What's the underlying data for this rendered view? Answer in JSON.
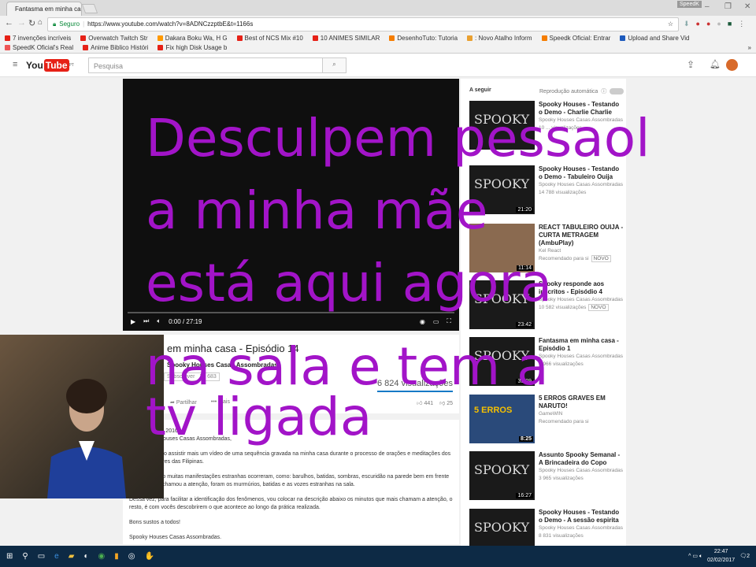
{
  "browser": {
    "tab_title": "Fantasma em minha casa",
    "profile": "SpeedK",
    "secure_label": "Seguro",
    "url": "https://www.youtube.com/watch?v=8ADNCzzptbE&t=1166s",
    "bookmarks": [
      "7 invenções incríveis",
      "Overwatch Twitch Str",
      "Dakara Boku Wa, H G",
      "Best of NCS Mix #10",
      "10 ANIMES SIMILAR",
      "DesenhoTuto: Tutoria",
      ": Novo Atalho Inform",
      "Speedk Oficial: Entrar",
      "Upload and Share Vid",
      "SpeedK Oficial's Real",
      "Anime Biblico Históri",
      "Fix high Disk Usage b"
    ],
    "more": "»"
  },
  "youtube": {
    "logo_you": "You",
    "logo_tube": "Tube",
    "region": "PT",
    "search_placeholder": "Pesquisa"
  },
  "player": {
    "time": "0:00 / 27:19"
  },
  "video": {
    "title": "em minha casa - Episódio 14",
    "channel": "Spooky Houses Casas Assombradas",
    "subscribe": "Subscrever",
    "subs": "20 683",
    "views": "6 824 visualizações",
    "share": "Partilhar",
    "more": "Mais",
    "likes": "441",
    "dislikes": "25"
  },
  "description": [
    "Publicado a ... 2016",
    "Olá Spooky Houses Casas Assombradas,",
    "Hoje vocês vão assistir mais um vídeo de uma sequência gravada na minha casa durante o processo de orações e meditações dos grandes mestres das Filipinas.",
    "Neste episódio muitas manifestações estranhas ocorreram, como: barulhos, batidas, sombras, escuridão na parede bem em frente e o que mais chamou a atenção, foram os murmúrios, batidas e as vozes estranhas na sala.",
    "Dessa vez, para facilitar a identificação dos fenômenos, vou colocar na descrição abaixo os minutos que mais chamam a atenção, o resto, é com vocês descobrirem o que acontece ao longo da prática realizada.",
    "Bons sustos a todos!",
    "Spooky Houses Casas Assombradas."
  ],
  "sidebar": {
    "up_next": "A seguir",
    "autoplay": "Reprodução automática",
    "items": [
      {
        "title": "Spooky Houses - Testando o Demo - Charlie Charlie",
        "channel": "Spooky Houses Casas Assombradas",
        "views": "10 ... visualizações",
        "duration": "",
        "thumb": "SPOOKY"
      },
      {
        "title": "Spooky Houses - Testando o Demo - Tabuleiro Ouija",
        "channel": "Spooky Houses Casas Assombradas",
        "views": "14 788 visualizações",
        "duration": "21:20",
        "thumb": "SPOOKY"
      },
      {
        "title": "REACT TABULEIRO OUIJA - CURTA METRAGEM (AmbuPlay)",
        "channel": "Kel React",
        "views": "Recomendado para si",
        "badge": "NOVO",
        "duration": "11:14",
        "thumb": ""
      },
      {
        "title": "Spooky responde aos inscritos - Episódio 4",
        "channel": "Spooky Houses Casas Assombradas",
        "views": "10 582 visualizações",
        "badge": "NOVO",
        "duration": "23:42",
        "thumb": "SPOOKY"
      },
      {
        "title": "Fantasma em minha casa - Episódio 1",
        "channel": "Spooky Houses Casas Assombradas",
        "views": "6 966 visualizações",
        "duration": "35:29",
        "thumb": "SPOOKY"
      },
      {
        "title": "5 ERROS GRAVES EM NARUTO!",
        "channel": "GameWIN",
        "views": "Recomendado para si",
        "duration": "8:25",
        "thumb": "5 ERROS"
      },
      {
        "title": "Assunto Spooky Semanal - A Brincadeira do Copo",
        "channel": "Spooky Houses Casas Assombradas",
        "views": "3 965 visualizações",
        "duration": "16:27",
        "thumb": "SPOOKY"
      },
      {
        "title": "Spooky Houses - Testando o Demo - A sessão espirita",
        "channel": "Spooky Houses Casas Assombradas",
        "views": "8 831 visualizações",
        "duration": "",
        "thumb": "SPOOKY"
      }
    ]
  },
  "overlay": [
    "Desculpem pessaol",
    "a minha mãe",
    "está aqui agora",
    "na sala e tem a",
    "tv ligada"
  ],
  "taskbar": {
    "time": "22:47",
    "date": "02/02/2017",
    "notifications": "2"
  }
}
